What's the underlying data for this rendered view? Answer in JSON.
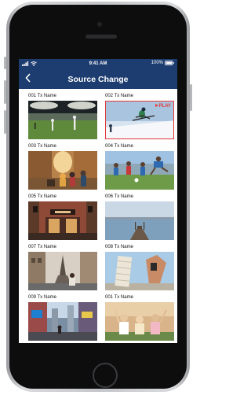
{
  "status": {
    "time": "9:41 AM",
    "battery": "100%"
  },
  "nav": {
    "title": "Source Change",
    "back_icon": "chevron-left-icon"
  },
  "tiles": [
    {
      "label": "001 Tx Name",
      "scene": "soccer-stadium"
    },
    {
      "label": "002 Tx Name",
      "scene": "skier-jump",
      "badge": "PLAY",
      "selected": true
    },
    {
      "label": "003 Tx Name",
      "scene": "city-street-people"
    },
    {
      "label": "004 Tx Name",
      "scene": "kids-soccer-sunny"
    },
    {
      "label": "005 Tx Name",
      "scene": "shop-front"
    },
    {
      "label": "006 Tx Name",
      "scene": "lake-pier"
    },
    {
      "label": "007 Tx Name",
      "scene": "paris-eiffel"
    },
    {
      "label": "008 Tx Name",
      "scene": "pisa-tower"
    },
    {
      "label": "009 Tx Name",
      "scene": "urban-street"
    },
    {
      "label": "001 Tx Name",
      "scene": "friends-selfie"
    }
  ],
  "colors": {
    "header": "#1d3d70",
    "selection": "#e23a3a"
  }
}
